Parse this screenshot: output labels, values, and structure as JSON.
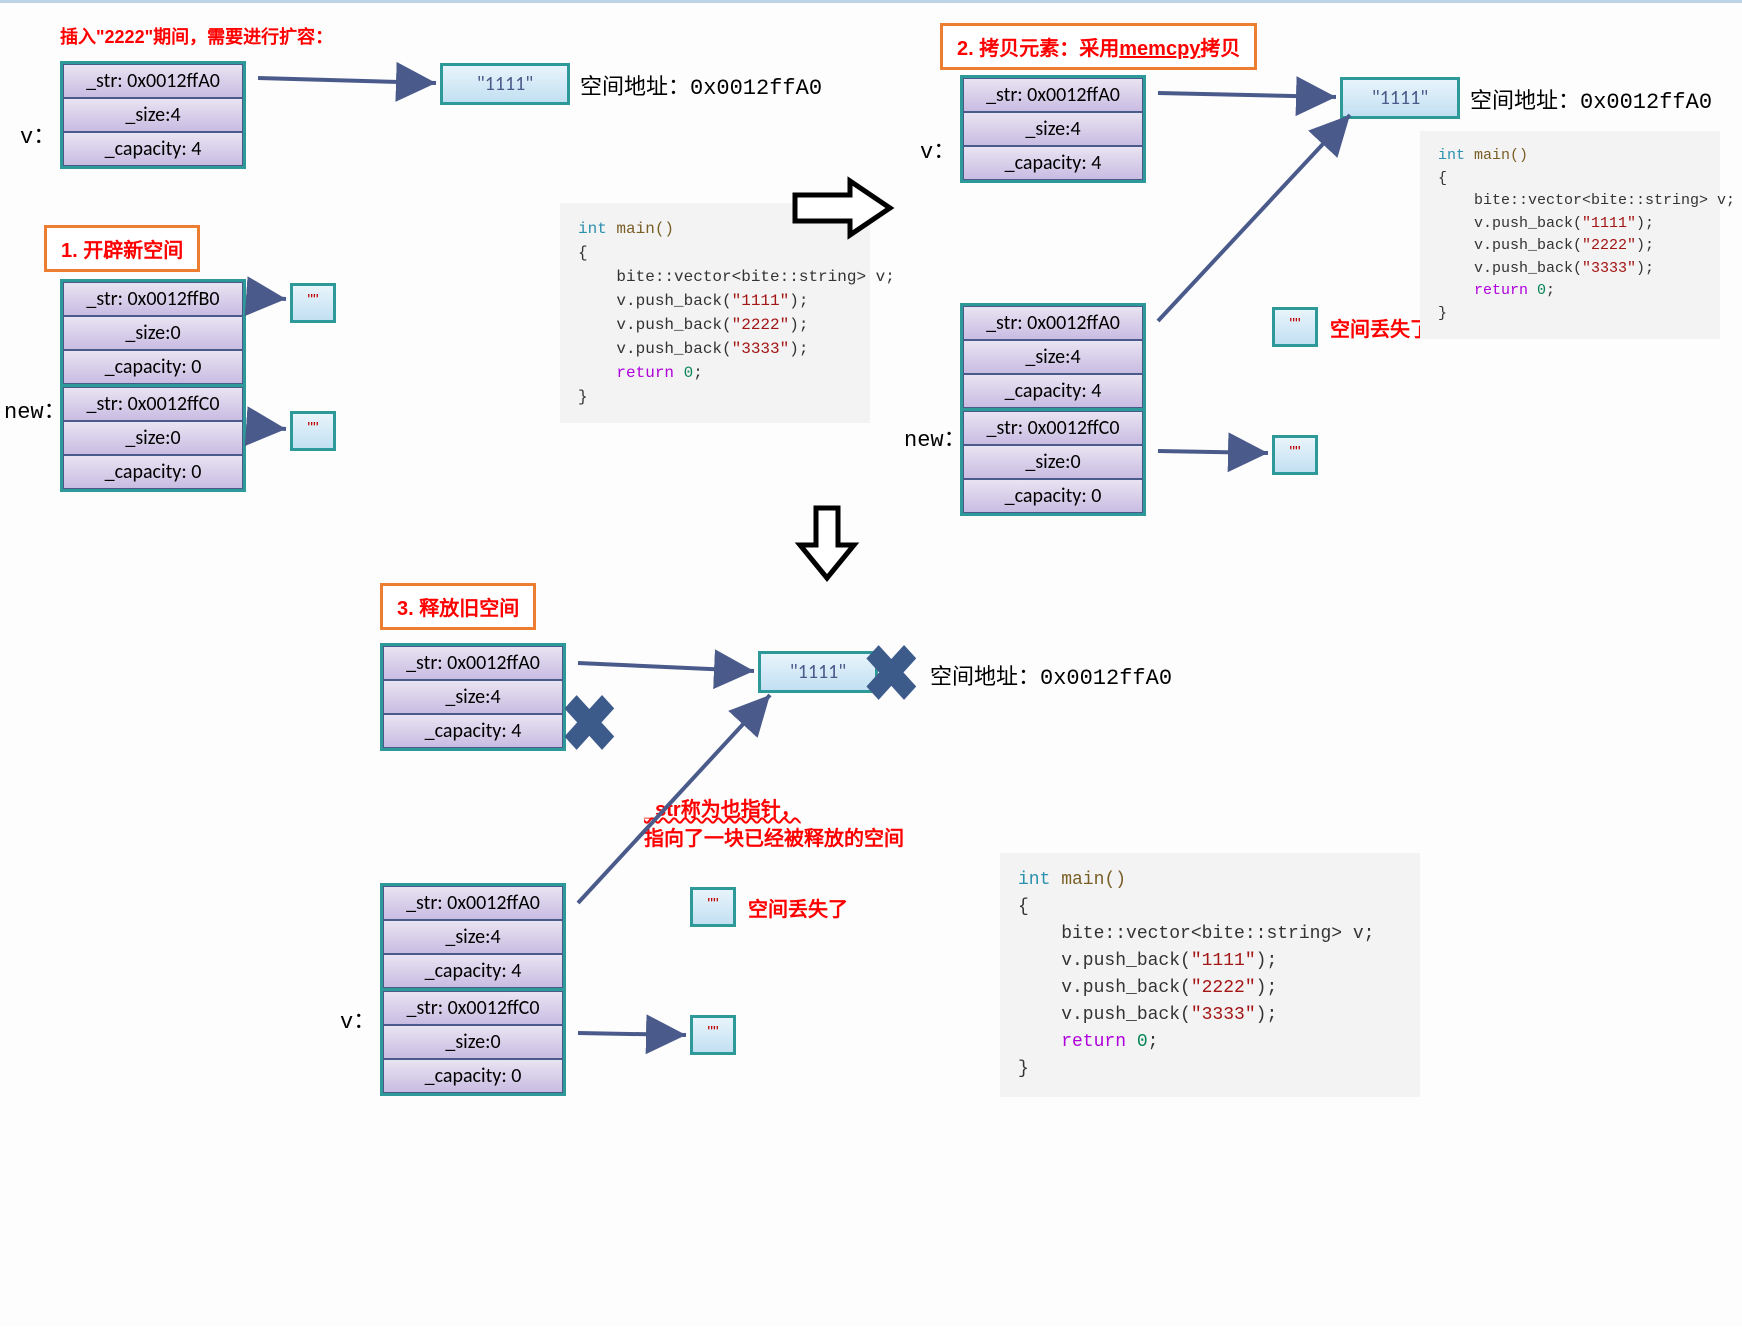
{
  "panel1": {
    "title": "插入\"2222\"期间，需要进行扩容：",
    "v_label": "v：",
    "tbl_v": {
      "str": "_str: 0x0012ffA0",
      "size": "_size:4",
      "cap": "_capacity: 4"
    },
    "val1111": "\"1111\"",
    "addr_label": "空间地址：0x0012ffA0",
    "tag1": "1. 开辟新空间",
    "new_label": "new：",
    "tbl_b": {
      "str": "_str: 0x0012ffB0",
      "size": "_size:0",
      "cap": "_capacity: 0"
    },
    "tbl_c": {
      "str": "_str: 0x0012ffC0",
      "size": "_size:0",
      "cap": "_capacity: 0"
    },
    "empty_quote": "\"\""
  },
  "code1": {
    "l1a": "int",
    "l1b": " main()",
    "l2": "{",
    "l3": "    bite::vector<bite::string> v;",
    "l4a": "    v.push_back(",
    "l4b": "\"1111\"",
    "l4c": ");",
    "l5a": "    v.push_back(",
    "l5b": "\"2222\"",
    "l5c": ");",
    "l6a": "    v.push_back(",
    "l6b": "\"3333\"",
    "l6c": ");",
    "l7a": "    return ",
    "l7b": "0",
    "l7c": ";",
    "l8": "}"
  },
  "panel2": {
    "tag2_a": "2. 拷贝元素：采用",
    "tag2_b": "memcpy",
    "tag2_c": "拷贝",
    "v_label": "v：",
    "tbl_v": {
      "str": "_str: 0x0012ffA0",
      "size": "_size:4",
      "cap": "_capacity: 4"
    },
    "val1111": "\"1111\"",
    "addr_label": "空间地址：0x0012ffA0",
    "lost_label": "空间丢失了",
    "new_label": "new：",
    "tbl_a2": {
      "str": "_str: 0x0012ffA0",
      "size": "_size:4",
      "cap": "_capacity: 4"
    },
    "tbl_c2": {
      "str": "_str: 0x0012ffC0",
      "size": "_size:0",
      "cap": "_capacity: 0"
    },
    "empty_quote": "\"\""
  },
  "panel3": {
    "tag3": "3. 释放旧空间",
    "tbl_v": {
      "str": "_str: 0x0012ffA0",
      "size": "_size:4",
      "cap": "_capacity: 4"
    },
    "val1111": "\"1111\"",
    "addr_label": "空间地址：0x0012ffA0",
    "note1": "_str称为也指针，",
    "note2": "指向了一块已经被释放的空间",
    "v_label": "v：",
    "tbl_a2": {
      "str": "_str: 0x0012ffA0",
      "size": "_size:4",
      "cap": "_capacity: 4"
    },
    "tbl_c2": {
      "str": "_str: 0x0012ffC0",
      "size": "_size:0",
      "cap": "_capacity: 0"
    },
    "empty_quote": "\"\"",
    "lost_label": "空间丢失了"
  }
}
